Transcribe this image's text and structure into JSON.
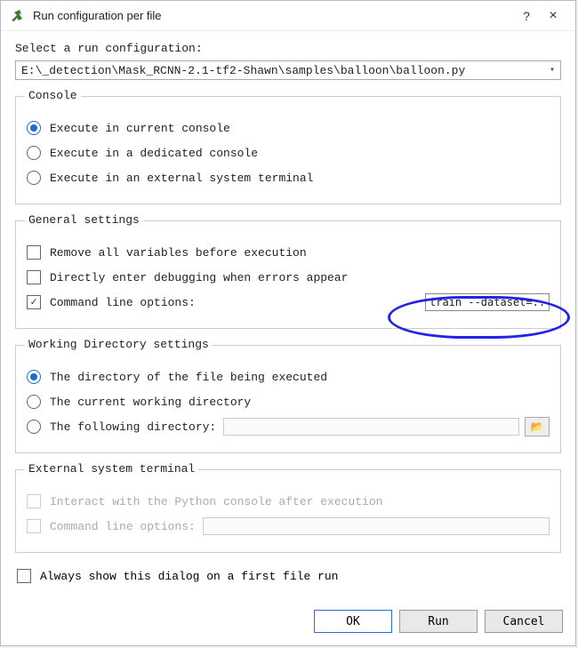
{
  "titlebar": {
    "title": "Run configuration per file",
    "help": "?",
    "close": "×"
  },
  "prompt": "Select a run configuration:",
  "filepath": "E:\\_detection\\Mask_RCNN-2.1-tf2-Shawn\\samples\\balloon\\balloon.py",
  "console": {
    "legend": "Console",
    "opt1": "Execute in current console",
    "opt2": "Execute in a dedicated console",
    "opt3": "Execute in an external system terminal"
  },
  "general": {
    "legend": "General settings",
    "chk1": "Remove all variables before execution",
    "chk2": "Directly enter debugging when errors appear",
    "chk3": "Command line options:",
    "cli_value": "train --dataset=../.."
  },
  "workdir": {
    "legend": "Working Directory settings",
    "opt1": "The directory of the file being executed",
    "opt2": "The current working directory",
    "opt3": "The following directory:",
    "folder_icon": "📂"
  },
  "external": {
    "legend": "External system terminal",
    "chk1": "Interact with the Python console after execution",
    "chk2": "Command line options:"
  },
  "always": "Always show this dialog on a first file run",
  "buttons": {
    "ok": "OK",
    "run": "Run",
    "cancel": "Cancel"
  }
}
